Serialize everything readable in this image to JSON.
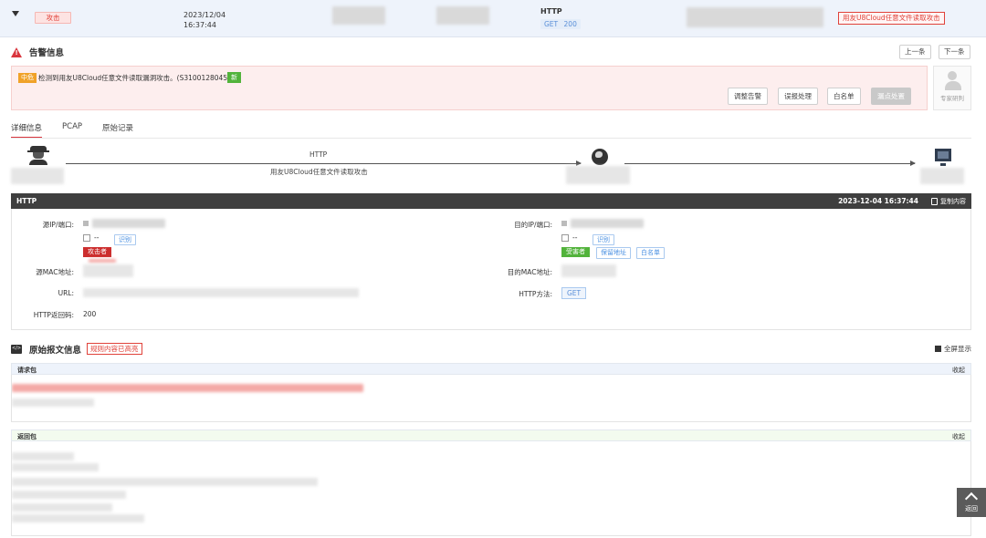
{
  "top_row": {
    "attack_tag": "攻击",
    "date": "2023/12/04",
    "time": "16:37:44",
    "protocol": "HTTP",
    "method": "GET",
    "status_code": "200",
    "rule_name": "用友U8Cloud任意文件读取攻击"
  },
  "alert": {
    "title": "告警信息",
    "prev_label": "上一条",
    "next_label": "下一条",
    "severity": "中危",
    "message": "检测到用友U8Cloud任意文件读取漏洞攻击。(S3100128045)",
    "new_tag": "新",
    "actions": [
      "调整告警",
      "误报处理",
      "白名单",
      "漏点处置"
    ],
    "expert_label": "专家研判"
  },
  "tabs": [
    {
      "label": "详细信息",
      "active": true
    },
    {
      "label": "PCAP",
      "active": false
    },
    {
      "label": "原始记录",
      "active": false
    }
  ],
  "flow": {
    "protocol": "HTTP",
    "description": "用友U8Cloud任意文件读取攻击"
  },
  "detail": {
    "header": "HTTP",
    "timestamp": "2023-12-04 16:37:44",
    "copy_label": "复制内容",
    "src_label": "源IP/端口:",
    "dst_label": "目的IP/端口:",
    "src_mac_label": "源MAC地址:",
    "dst_mac_label": "目的MAC地址:",
    "url_label": "URL:",
    "http_method_label": "HTTP方法:",
    "http_code_label": "HTTP返回码:",
    "http_method": "GET",
    "http_code": "200",
    "dash": "--",
    "src_sub_btn": "识别",
    "dst_sub_btn": "识别",
    "attacker_tag": "攻击者",
    "victim_tag": "受害者",
    "keep_addr_btn": "保留地址",
    "whitelist_btn": "白名单"
  },
  "raw": {
    "title": "原始报文信息",
    "rule_highlight": "规则内容已高亮",
    "fullscreen": "全屏显示",
    "request_label": "请求包",
    "response_label": "返回包",
    "collapse": "收起"
  },
  "back_button": "返回"
}
